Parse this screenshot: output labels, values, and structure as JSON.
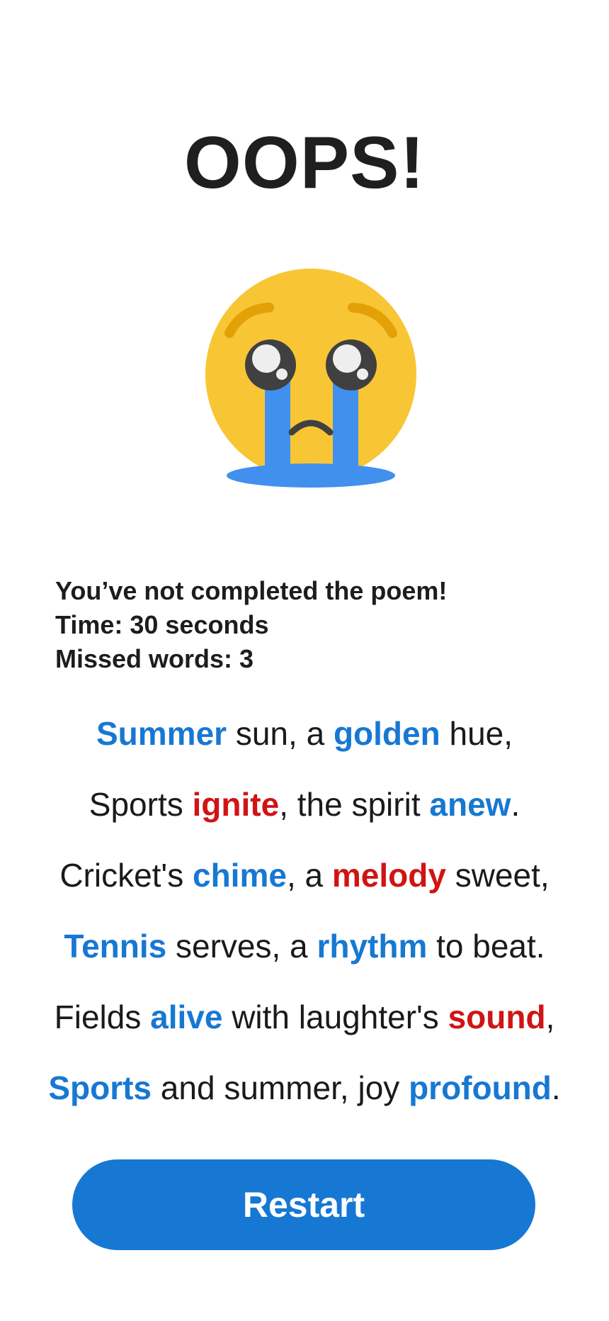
{
  "header": {
    "title": "OOPS!"
  },
  "emoji": {
    "icon": "crying-face-icon"
  },
  "result": {
    "message": "You’ve not completed the poem!",
    "time": "Time: 30 seconds",
    "missed": "Missed words: 3"
  },
  "colors": {
    "correct_word": "#1778d2",
    "missed_word": "#d01414",
    "button": "#1678d3"
  },
  "poem": {
    "lines": [
      {
        "parts": [
          {
            "text": "Summer",
            "type": "correct"
          },
          {
            "text": " sun, a ",
            "type": "plain"
          },
          {
            "text": "golden",
            "type": "correct"
          },
          {
            "text": " hue,",
            "type": "plain"
          }
        ]
      },
      {
        "parts": [
          {
            "text": "Sports ",
            "type": "plain"
          },
          {
            "text": "ignite",
            "type": "missed"
          },
          {
            "text": ", the spirit ",
            "type": "plain"
          },
          {
            "text": "anew",
            "type": "correct"
          },
          {
            "text": ".",
            "type": "plain"
          }
        ]
      },
      {
        "parts": [
          {
            "text": "Cricket's ",
            "type": "plain"
          },
          {
            "text": "chime",
            "type": "correct"
          },
          {
            "text": ", a ",
            "type": "plain"
          },
          {
            "text": "melody",
            "type": "missed"
          },
          {
            "text": " sweet,",
            "type": "plain"
          }
        ]
      },
      {
        "parts": [
          {
            "text": "Tennis",
            "type": "correct"
          },
          {
            "text": " serves, a ",
            "type": "plain"
          },
          {
            "text": "rhythm",
            "type": "correct"
          },
          {
            "text": " to beat.",
            "type": "plain"
          }
        ]
      },
      {
        "parts": [
          {
            "text": "Fields ",
            "type": "plain"
          },
          {
            "text": "alive",
            "type": "correct"
          },
          {
            "text": " with laughter's ",
            "type": "plain"
          },
          {
            "text": "sound",
            "type": "missed"
          },
          {
            "text": ",",
            "type": "plain"
          }
        ]
      },
      {
        "parts": [
          {
            "text": "Sports",
            "type": "correct"
          },
          {
            "text": " and summer, joy ",
            "type": "plain"
          },
          {
            "text": "profound",
            "type": "correct"
          },
          {
            "text": ".",
            "type": "plain"
          }
        ]
      }
    ]
  },
  "actions": {
    "restart_label": "Restart"
  }
}
